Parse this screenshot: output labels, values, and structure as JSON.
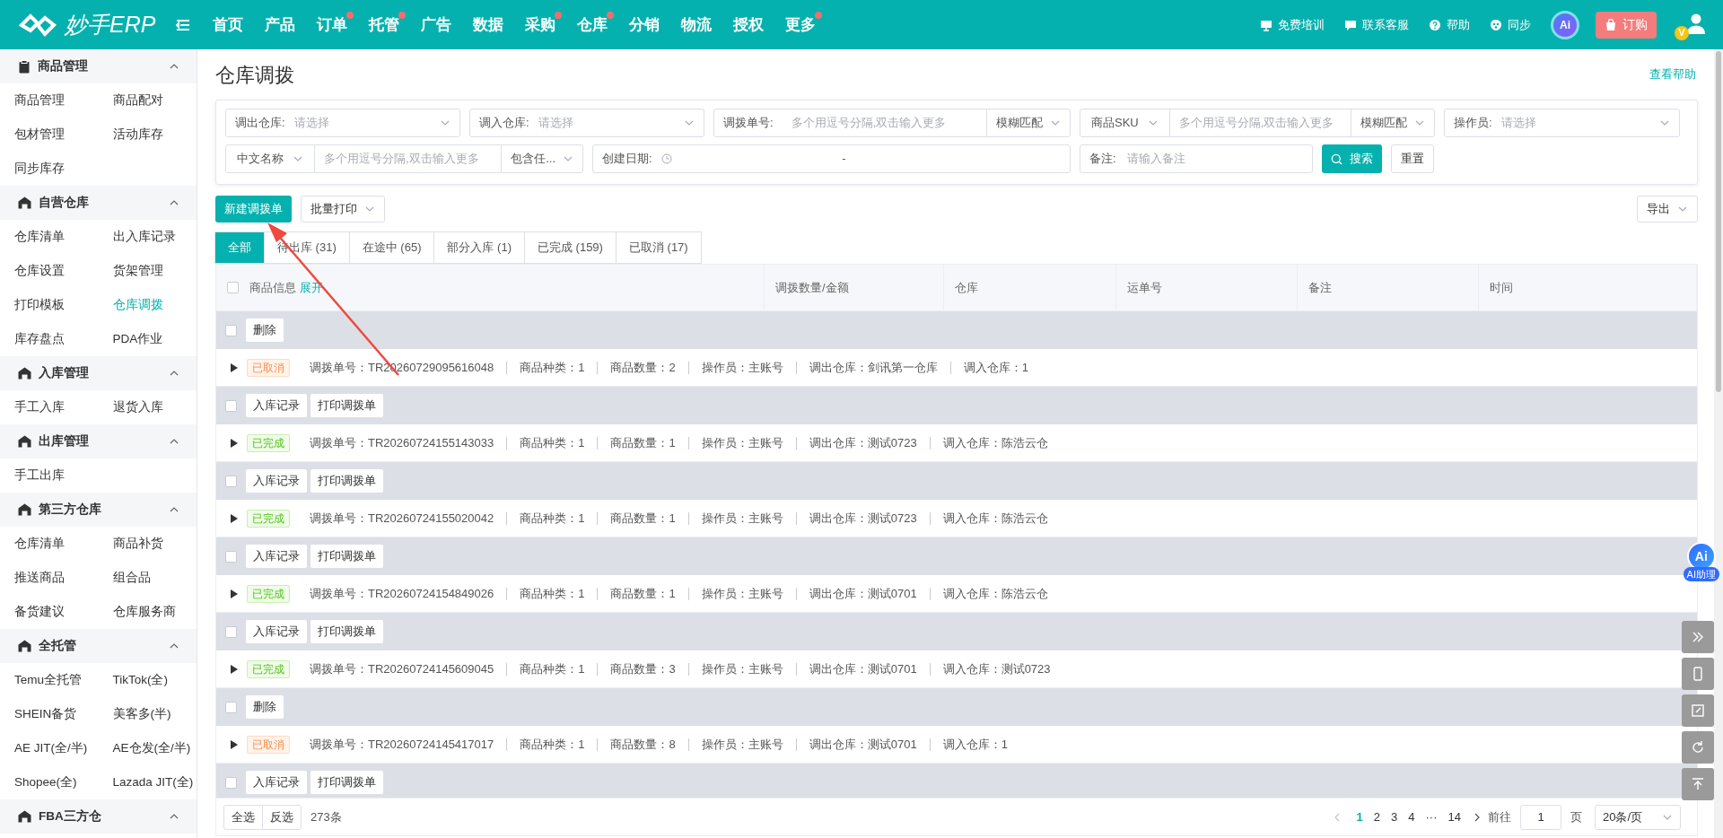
{
  "app": {
    "logo_text": "妙手ERP"
  },
  "nav": [
    {
      "label": "首页",
      "badge": false
    },
    {
      "label": "产品",
      "badge": false
    },
    {
      "label": "订单",
      "badge": true
    },
    {
      "label": "托管",
      "badge": true
    },
    {
      "label": "广告",
      "badge": false
    },
    {
      "label": "数据",
      "badge": false
    },
    {
      "label": "采购",
      "badge": true
    },
    {
      "label": "仓库",
      "badge": true
    },
    {
      "label": "分销",
      "badge": false
    },
    {
      "label": "物流",
      "badge": false
    },
    {
      "label": "授权",
      "badge": false
    },
    {
      "label": "更多",
      "badge": true
    }
  ],
  "header_links": [
    {
      "kind": "training",
      "label": "免费培训"
    },
    {
      "kind": "service",
      "label": "联系客服"
    },
    {
      "kind": "help",
      "label": "帮助"
    },
    {
      "kind": "sync",
      "label": "同步"
    }
  ],
  "ai_button_text": "Ai",
  "order_button": "订购",
  "vip_badge": "V",
  "sidebar": [
    {
      "title": "商品管理",
      "expanded": true,
      "items": [
        {
          "label": "商品管理",
          "selected": false
        },
        {
          "label": "商品配对",
          "selected": false
        },
        {
          "label": "包材管理",
          "selected": false
        },
        {
          "label": "活动库存",
          "selected": false
        },
        {
          "label": "同步库存",
          "selected": false
        }
      ]
    },
    {
      "title": "自营仓库",
      "expanded": true,
      "items": [
        {
          "label": "仓库清单",
          "selected": false
        },
        {
          "label": "出入库记录",
          "selected": false
        },
        {
          "label": "仓库设置",
          "selected": false
        },
        {
          "label": "货架管理",
          "selected": false
        },
        {
          "label": "打印模板",
          "selected": false
        },
        {
          "label": "仓库调拨",
          "selected": true
        },
        {
          "label": "库存盘点",
          "selected": false
        },
        {
          "label": "PDA作业",
          "selected": false
        }
      ]
    },
    {
      "title": "入库管理",
      "expanded": true,
      "items": [
        {
          "label": "手工入库",
          "selected": false
        },
        {
          "label": "退货入库",
          "selected": false
        }
      ]
    },
    {
      "title": "出库管理",
      "expanded": true,
      "items": [
        {
          "label": "手工出库",
          "selected": false
        }
      ]
    },
    {
      "title": "第三方仓库",
      "expanded": true,
      "items": [
        {
          "label": "仓库清单",
          "selected": false
        },
        {
          "label": "商品补货",
          "selected": false
        },
        {
          "label": "推送商品",
          "selected": false
        },
        {
          "label": "组合品",
          "selected": false
        },
        {
          "label": "备货建议",
          "selected": false
        },
        {
          "label": "仓库服务商",
          "selected": false
        }
      ]
    },
    {
      "title": "全托管",
      "expanded": true,
      "items": [
        {
          "label": "Temu全托管",
          "selected": false
        },
        {
          "label": "TikTok(全)",
          "selected": false
        },
        {
          "label": "SHEIN备货",
          "selected": false
        },
        {
          "label": "美客多(半)",
          "selected": false
        },
        {
          "label": "AE JIT(全/半)",
          "selected": false
        },
        {
          "label": "AE仓发(全/半)",
          "selected": false
        },
        {
          "label": "Shopee(全)",
          "selected": false
        },
        {
          "label": "Lazada JIT(全)",
          "selected": false
        }
      ]
    },
    {
      "title": "FBA三方仓",
      "expanded": true
    }
  ],
  "page": {
    "title": "仓库调拨",
    "help_link": "查看帮助"
  },
  "filters": [
    [
      {
        "kind": "select",
        "label": "调出仓库:",
        "placeholder": "请选择"
      },
      {
        "kind": "select",
        "label": "调入仓库:",
        "placeholder": "请选择"
      },
      {
        "kind": "labeled-match",
        "label": "调拨单号:",
        "placeholder": "多个用逗号分隔,双击输入更多",
        "match": "模糊匹配"
      },
      {
        "kind": "combo",
        "prefix": "商品SKU",
        "placeholder": "多个用逗号分隔,双击输入更多",
        "match": "模糊匹配"
      },
      {
        "kind": "select",
        "label": "操作员:",
        "placeholder": "请选择"
      }
    ],
    [
      {
        "kind": "combo",
        "prefix": "中文名称",
        "placeholder": "多个用逗号分隔,双击输入更多",
        "match": "包含任..."
      },
      {
        "kind": "date",
        "label": "创建日期:",
        "separator": "-"
      },
      {
        "kind": "text",
        "label": "备注:",
        "placeholder": "请输入备注"
      }
    ]
  ],
  "search_button": "搜索",
  "reset_button": "重置",
  "toolbar": {
    "create": "新建调拨单",
    "batch_print": "批量打印",
    "export": "导出"
  },
  "tabs": [
    {
      "label": "全部",
      "selected": true
    },
    {
      "label": "待出库 (31)",
      "selected": false
    },
    {
      "label": "在途中 (65)",
      "selected": false
    },
    {
      "label": "部分入库 (1)",
      "selected": false
    },
    {
      "label": "已完成 (159)",
      "selected": false
    },
    {
      "label": "已取消 (17)",
      "selected": false
    }
  ],
  "table": {
    "select_all_checked": false,
    "columns": [
      "商品信息",
      "调拨数量/金额",
      "仓库",
      "运单号",
      "备注",
      "时间"
    ],
    "expand_link": "展开",
    "orders": [
      {
        "checked": false,
        "actions": [
          "删除"
        ],
        "status": {
          "kind": "cancelled",
          "label": "已取消"
        },
        "fields": [
          "调拨单号：TR20260729095616048",
          "商品种类：1",
          "商品数量：2",
          "操作员：主账号",
          "调出仓库：剑讯第一仓库",
          "调入仓库：1"
        ]
      },
      {
        "checked": false,
        "actions": [
          "入库记录",
          "打印调拨单"
        ],
        "status": {
          "kind": "done",
          "label": "已完成"
        },
        "fields": [
          "调拨单号：TR20260724155143033",
          "商品种类：1",
          "商品数量：1",
          "操作员：主账号",
          "调出仓库：测试0723",
          "调入仓库：陈浩云仓"
        ]
      },
      {
        "checked": false,
        "actions": [
          "入库记录",
          "打印调拨单"
        ],
        "status": {
          "kind": "done",
          "label": "已完成"
        },
        "fields": [
          "调拨单号：TR20260724155020042",
          "商品种类：1",
          "商品数量：1",
          "操作员：主账号",
          "调出仓库：测试0723",
          "调入仓库：陈浩云仓"
        ]
      },
      {
        "checked": false,
        "actions": [
          "入库记录",
          "打印调拨单"
        ],
        "status": {
          "kind": "done",
          "label": "已完成"
        },
        "fields": [
          "调拨单号：TR20260724154849026",
          "商品种类：1",
          "商品数量：1",
          "操作员：主账号",
          "调出仓库：测试0701",
          "调入仓库：陈浩云仓"
        ]
      },
      {
        "checked": false,
        "actions": [
          "入库记录",
          "打印调拨单"
        ],
        "status": {
          "kind": "done",
          "label": "已完成"
        },
        "fields": [
          "调拨单号：TR20260724145609045",
          "商品种类：1",
          "商品数量：3",
          "操作员：主账号",
          "调出仓库：测试0701",
          "调入仓库：测试0723"
        ]
      },
      {
        "checked": false,
        "actions": [
          "删除"
        ],
        "status": {
          "kind": "cancelled",
          "label": "已取消"
        },
        "fields": [
          "调拨单号：TR20260724145417017",
          "商品种类：1",
          "商品数量：8",
          "操作员：主账号",
          "调出仓库：测试0701",
          "调入仓库：1"
        ]
      },
      {
        "checked": false,
        "actions": [
          "入库记录",
          "打印调拨单"
        ]
      }
    ]
  },
  "footer": {
    "select_all": "全选",
    "invert": "反选",
    "total": "273条",
    "pages": [
      {
        "label": "1",
        "selected": true
      },
      {
        "label": "2",
        "selected": false
      },
      {
        "label": "3",
        "selected": false
      },
      {
        "label": "4",
        "selected": false
      },
      {
        "label": "···",
        "selected": false
      },
      {
        "label": "14",
        "selected": false
      }
    ],
    "goto_label": "前往",
    "goto_value": "1",
    "page_unit": "页",
    "page_size": "20条/页"
  },
  "ai_assistant": {
    "icon_text": "Ai",
    "label": "AI助理"
  }
}
